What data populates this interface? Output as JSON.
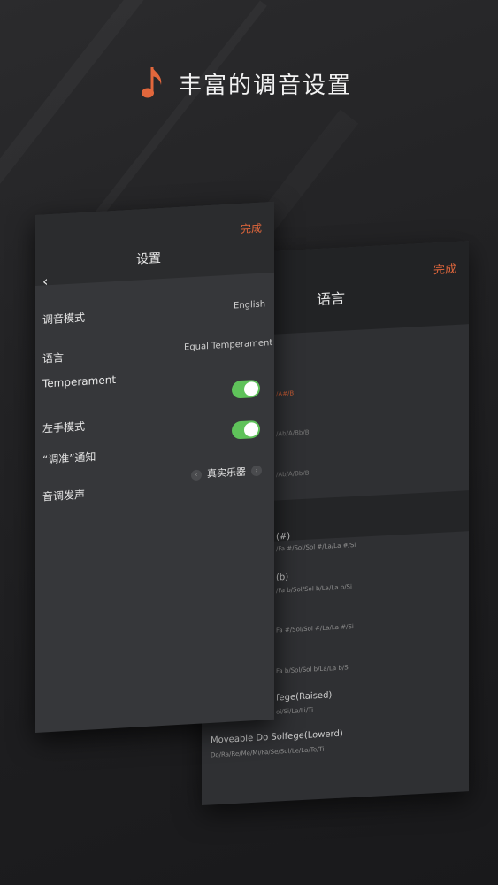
{
  "headline": {
    "title": "丰富的调音设置",
    "icon": "music-note-icon",
    "accent": "#e2673c"
  },
  "settings_screen": {
    "done_label": "完成",
    "title": "设置",
    "back_icon": "chevron-left-icon",
    "rows": [
      {
        "label": "调音模式",
        "value": "English"
      },
      {
        "label": "语言",
        "value": "Equal Temperament"
      },
      {
        "label": "Temperament",
        "toggle_on": true
      },
      {
        "label": "左手模式",
        "toggle_on": true
      },
      {
        "label": "“调准”通知"
      },
      {
        "label": "音调发声",
        "value": "真实乐器"
      }
    ],
    "toggle_color": "#5fc25a"
  },
  "language_screen": {
    "done_label": "完成",
    "title": "语言",
    "items": [
      {
        "text": "/A#/B",
        "style": "orange"
      },
      {
        "text": "/Ab/A/Bb/B",
        "style": "dim"
      },
      {
        "text": "/Ab/A/Bb/B",
        "style": "dim"
      },
      {
        "text": "(#)",
        "style": "main"
      },
      {
        "text": "/Fa #/Sol/Sol #/La/La #/Si",
        "style": "sub"
      },
      {
        "text": "(b)",
        "style": "main"
      },
      {
        "text": "/Fa b/Sol/Sol b/La/La b/Si",
        "style": "sub"
      },
      {
        "text": "Fa #/Sol/Sol #/La/La #/Si",
        "style": "sub"
      },
      {
        "text": "Fa b/Sol/Sol b/La/La b/Si",
        "style": "sub"
      },
      {
        "text": "fege(Raised)",
        "style": "main"
      },
      {
        "text": "oi/Si/La/Li/Ti",
        "style": "sub"
      },
      {
        "text": "Moveable Do Solfege(Lowerd)",
        "style": "main"
      },
      {
        "text": "Do/Ra/Re/Me/Mi/Fa/Se/Sol/Le/La/Te/Ti",
        "style": "sub"
      }
    ]
  }
}
